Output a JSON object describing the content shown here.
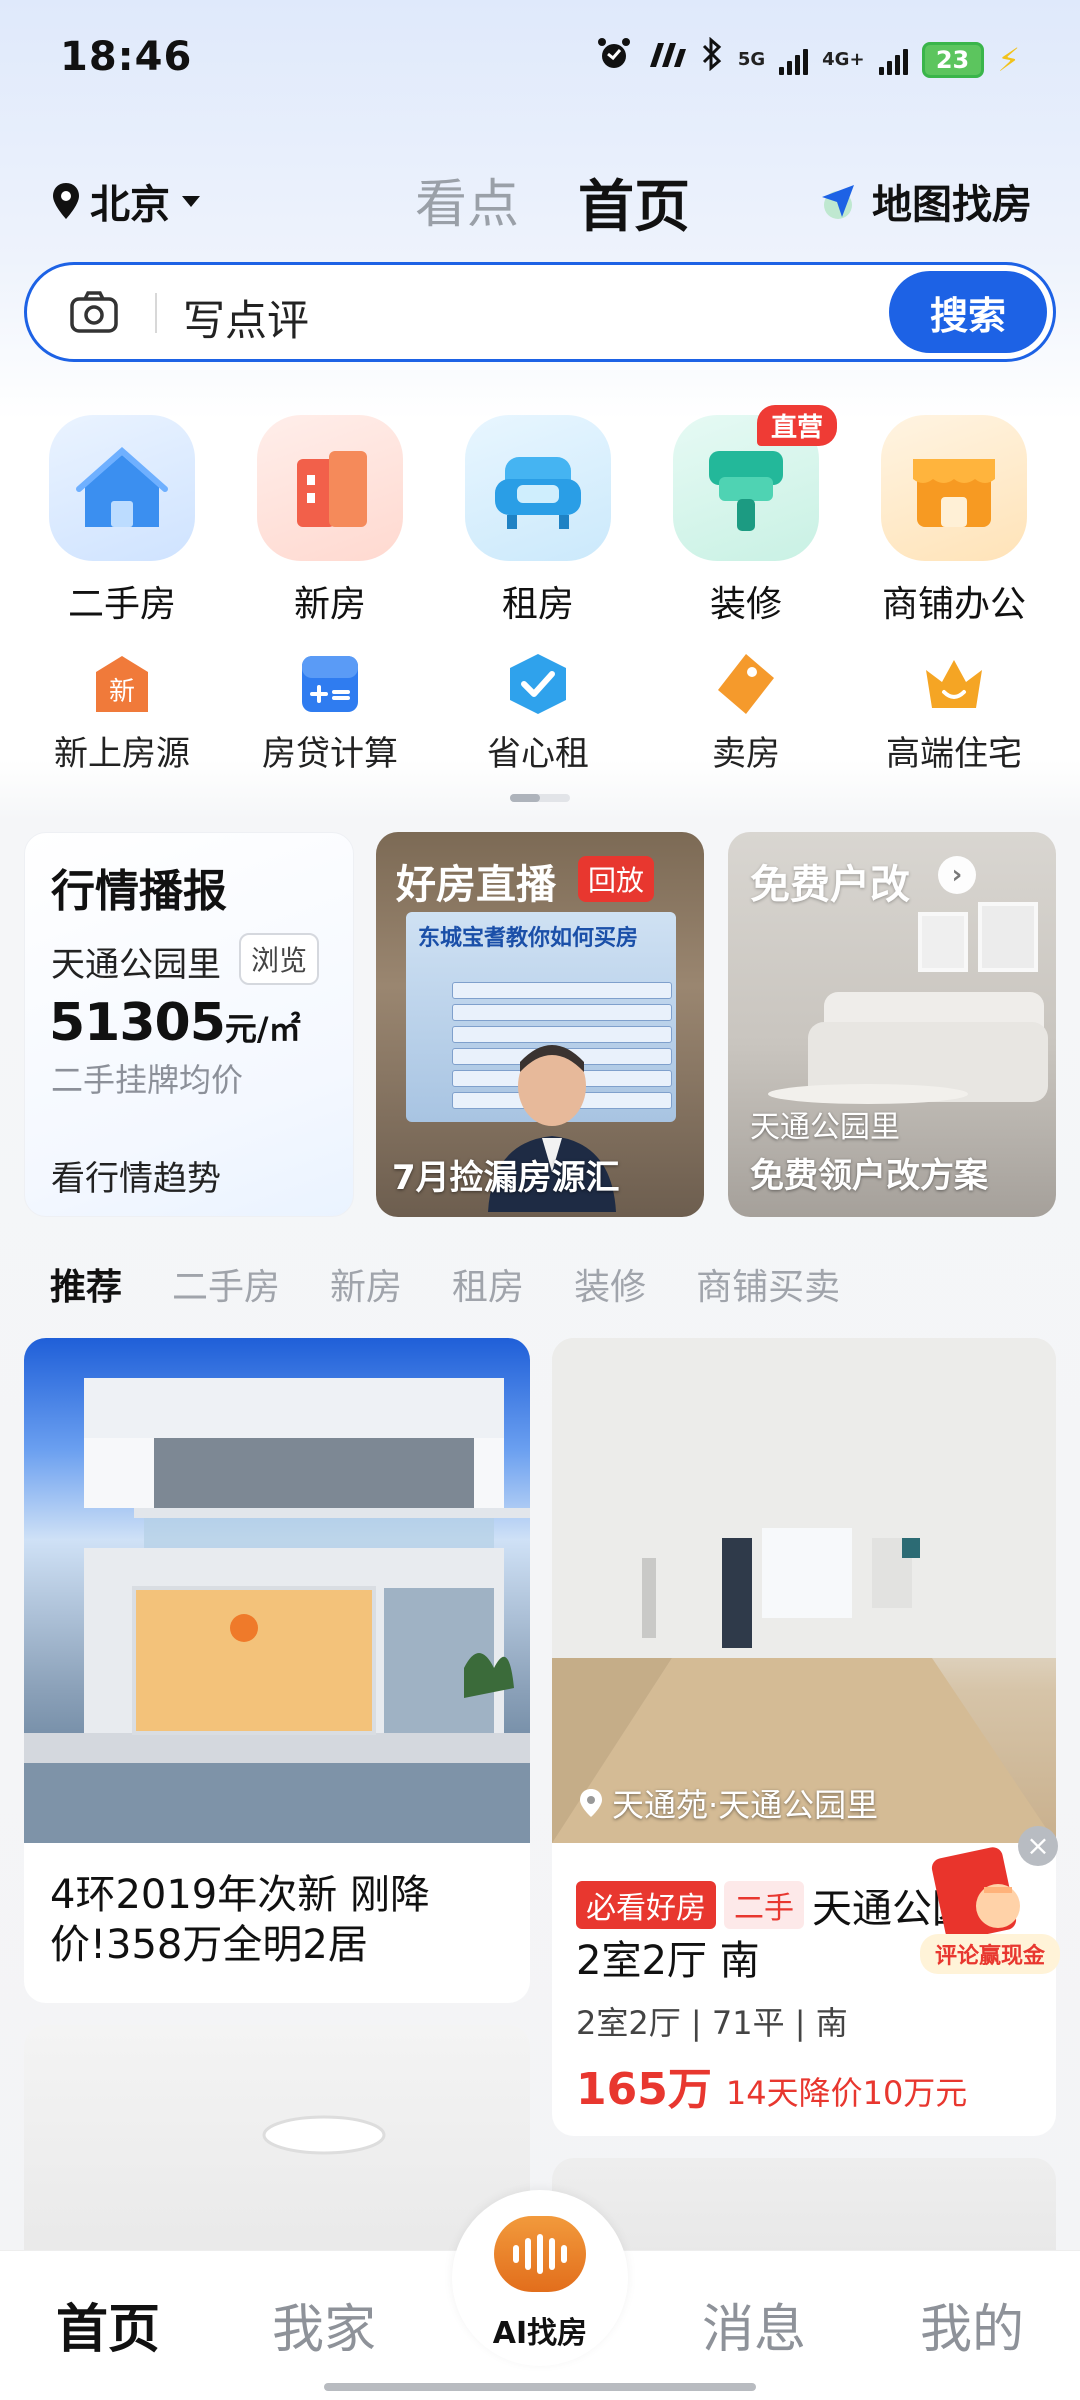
{
  "status_bar": {
    "time": "18:46",
    "network1": "5G",
    "network2": "4G+",
    "battery": "23",
    "icons": [
      "alarm-icon",
      "signal-app-icon",
      "bluetooth-icon",
      "cell-signal-icon",
      "battery-icon",
      "charging-icon"
    ]
  },
  "header": {
    "city": "北京",
    "tabs": [
      "看点",
      "首页"
    ],
    "active_tab": "首页",
    "map_label": "地图找房"
  },
  "search": {
    "placeholder": "写点评",
    "button": "搜索"
  },
  "main_grid": [
    {
      "label": "二手房",
      "icon": "house-icon",
      "color": "#3b8ff0"
    },
    {
      "label": "新房",
      "icon": "building-icon",
      "color": "#f2604a"
    },
    {
      "label": "租房",
      "icon": "sofa-icon",
      "color": "#2a9ee6"
    },
    {
      "label": "装修",
      "icon": "paint-roller-icon",
      "color": "#23b89a",
      "badge": "直营"
    },
    {
      "label": "商铺办公",
      "icon": "shop-icon",
      "color": "#f79a22"
    }
  ],
  "sub_grid": [
    {
      "label": "新上房源",
      "icon": "new-listing-icon",
      "glyph": "新"
    },
    {
      "label": "房贷计算",
      "icon": "calculator-icon"
    },
    {
      "label": "省心租",
      "icon": "check-icon"
    },
    {
      "label": "卖房",
      "icon": "tag-icon"
    },
    {
      "label": "高端住宅",
      "icon": "crown-icon"
    }
  ],
  "cards": {
    "market": {
      "title": "行情播报",
      "community": "天通公园里",
      "browse": "浏览",
      "price": "51305",
      "unit": "元/㎡",
      "sub": "二手挂牌均价",
      "link": "看行情趋势"
    },
    "live": {
      "title": "好房直播",
      "badge": "回放",
      "screen_title": "东城宝耆教你如何买房",
      "caption": "7月捡漏房源汇"
    },
    "renovation": {
      "title": "免费户改",
      "community": "天通公园里",
      "caption": "免费领户改方案"
    }
  },
  "feed_tabs": [
    "推荐",
    "二手房",
    "新房",
    "租房",
    "装修",
    "商铺买卖"
  ],
  "feed": {
    "left1": {
      "title": "4环2019年次新 刚降价!358万全明2居"
    },
    "right1": {
      "location": "天通苑·天通公园里",
      "tag1": "必看好房",
      "tag2": "二手",
      "name": "天通公园里",
      "layout": "2室2厅 南",
      "meta": "2室2厅 | 71平 | 南",
      "price": "165万",
      "drop": "14天降价10万元"
    }
  },
  "float_ad": {
    "label": "评论赢现金",
    "close": "×"
  },
  "bottom_nav": {
    "items": [
      "首页",
      "我家",
      "消息",
      "我的"
    ],
    "active": "首页",
    "ai_label": "AI找房"
  }
}
